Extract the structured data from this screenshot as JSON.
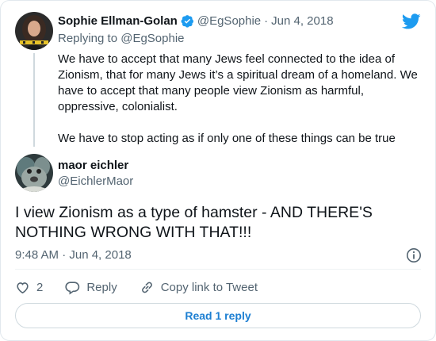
{
  "parent_tweet": {
    "name": "Sophie Ellman-Golan",
    "handle": "@EgSophie",
    "separator": "·",
    "date": "Jun 4, 2018",
    "replying_to_label": "Replying to",
    "replying_to_handle": "@EgSophie",
    "paragraph_1": "We have to accept that many Jews feel connected to the idea of Zionism, that for many Jews it’s a spiritual dream of a homeland. We have to accept that many people view Zionism as harmful, oppressive, colonialist.",
    "paragraph_2": "We have to stop acting as if only one of these things can be true",
    "verified_icon": "verified-badge-icon"
  },
  "main_tweet": {
    "name": "maor eichler",
    "handle": "@EichlerMaor",
    "text": "I view Zionism as a type of hamster - AND THERE'S NOTHING WRONG WITH THAT!!!",
    "timestamp": "9:48 AM · Jun 4, 2018"
  },
  "actions": {
    "like_count": "2",
    "reply_label": "Reply",
    "copy_link_label": "Copy link to Tweet"
  },
  "read_replies_label": "Read 1 reply",
  "colors": {
    "brand_blue": "#1d9bf0",
    "text_primary": "#0f1419",
    "text_secondary": "#536471",
    "border": "#cfd9de"
  },
  "icons": [
    "twitter-bird-icon",
    "verified-badge-icon",
    "info-icon",
    "heart-icon",
    "reply-icon",
    "link-icon"
  ]
}
